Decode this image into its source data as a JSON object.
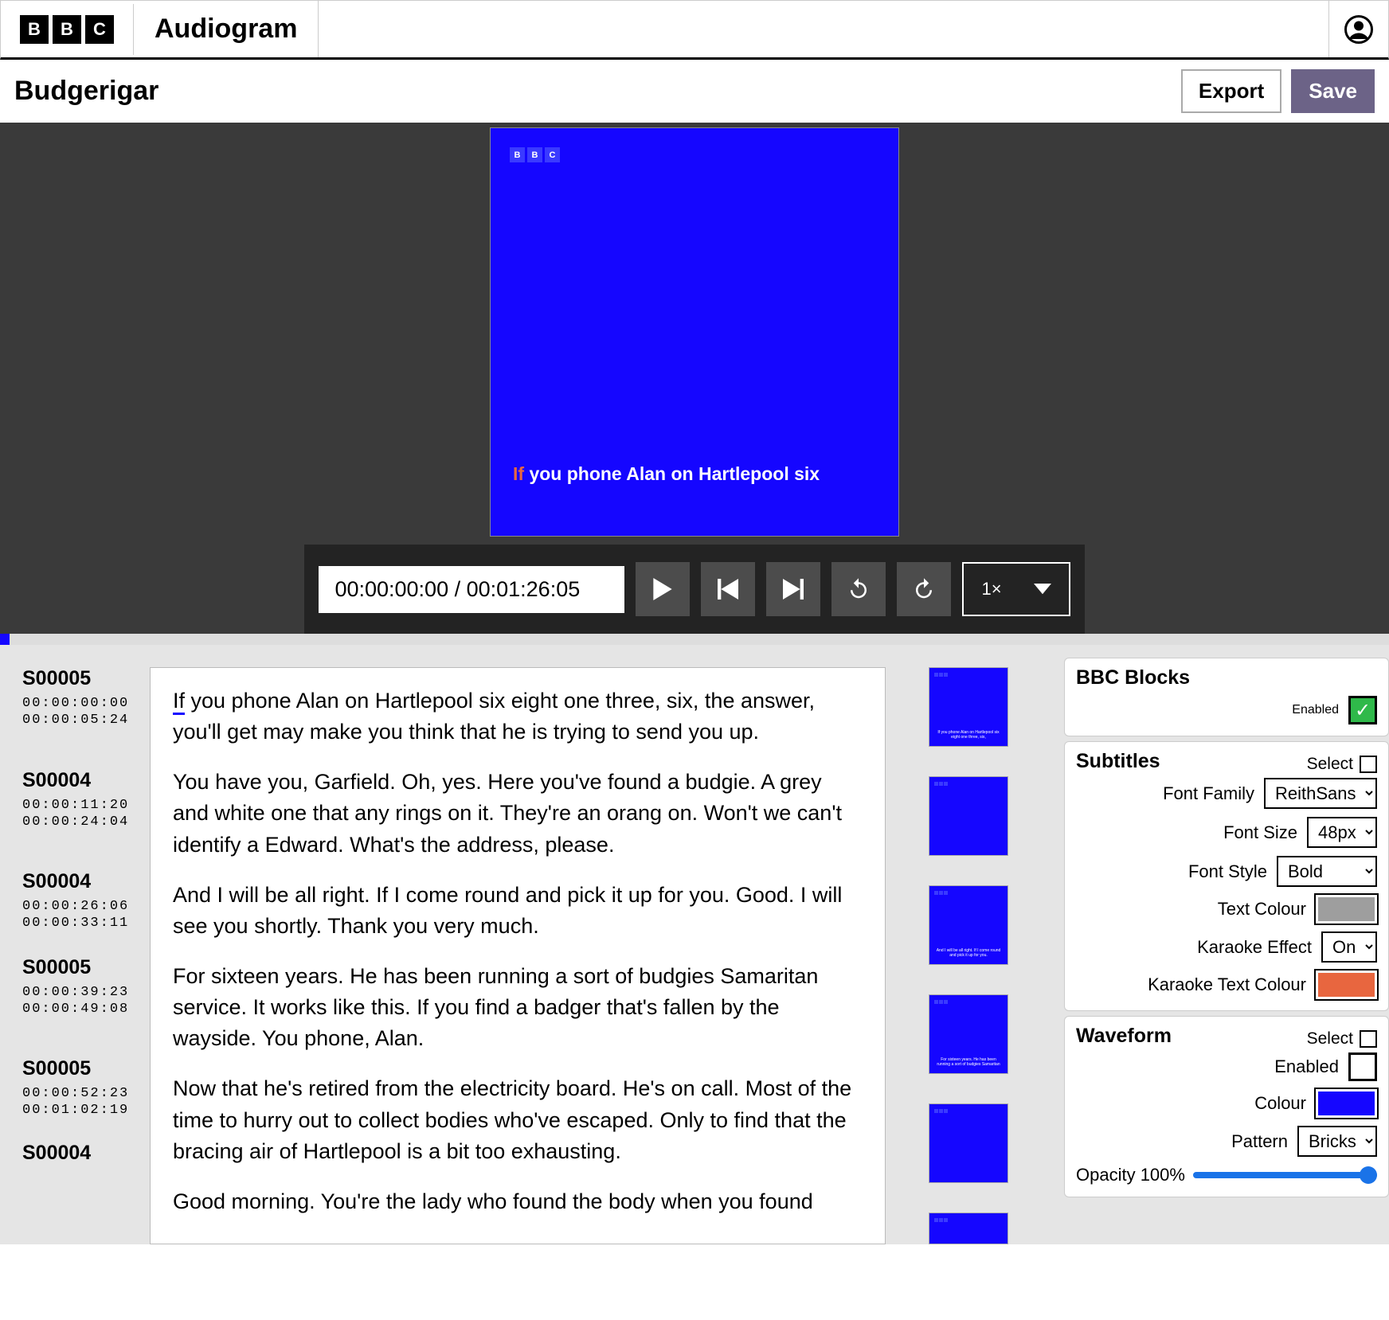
{
  "app": {
    "name": "Audiogram",
    "bbc": [
      "B",
      "B",
      "C"
    ]
  },
  "page": {
    "title": "Budgerigar",
    "export": "Export",
    "save": "Save"
  },
  "preview": {
    "subtitle_karaoke": "If",
    "subtitle_rest": " you phone Alan on Hartlepool six"
  },
  "controls": {
    "time": "00:00:00:00 / 00:01:26:05",
    "speed": "1×"
  },
  "segments": [
    {
      "sid": "S00005",
      "in": "00:00:00:00",
      "out": "00:00:05:24",
      "text": "If you phone Alan on Hartlepool six eight one three, six, the answer, you'll get may make you think that he is trying to send you up.",
      "first_word": "If"
    },
    {
      "sid": "S00004",
      "in": "00:00:11:20",
      "out": "00:00:24:04",
      "text": "You have you, Garfield. Oh, yes. Here you've found a budgie. A grey and white one that any rings on it. They're an orang on. Won't we can't identify a Edward. What's the address, please."
    },
    {
      "sid": "S00004",
      "in": "00:00:26:06",
      "out": "00:00:33:11",
      "text": "And I will be all right. If I come round and pick it up for you. Good. I will see you shortly. Thank you very much."
    },
    {
      "sid": "S00005",
      "in": "00:00:39:23",
      "out": "00:00:49:08",
      "text": "For sixteen years. He has been running a sort of budgies Samaritan service. It works like this. If you find a badger that's fallen by the wayside. You phone, Alan."
    },
    {
      "sid": "S00005",
      "in": "00:00:52:23",
      "out": "00:01:02:19",
      "text": "Now that he's retired from the electricity board. He's on call. Most of the time to hurry out to collect bodies who've escaped. Only to find that the bracing air of Hartlepool is a bit too exhausting."
    },
    {
      "sid": "S00004",
      "in": "",
      "out": "",
      "text": "Good morning. You're the lady who found the body when you found"
    }
  ],
  "panels": {
    "blocks": {
      "title": "BBC Blocks",
      "enabled_label": "Enabled"
    },
    "subtitles": {
      "title": "Subtitles",
      "select": "Select",
      "font_family_label": "Font Family",
      "font_family": "ReithSans",
      "font_size_label": "Font Size",
      "font_size": "48px",
      "font_style_label": "Font Style",
      "font_style": "Bold",
      "text_colour_label": "Text Colour",
      "text_colour": "#9e9e9e",
      "karaoke_label": "Karaoke Effect",
      "karaoke": "On",
      "karaoke_colour_label": "Karaoke Text Colour",
      "karaoke_colour": "#e8663f"
    },
    "waveform": {
      "title": "Waveform",
      "select": "Select",
      "enabled_label": "Enabled",
      "colour_label": "Colour",
      "colour": "#1506ff",
      "pattern_label": "Pattern",
      "pattern": "Bricks",
      "opacity_label": "Opacity 100%"
    }
  }
}
